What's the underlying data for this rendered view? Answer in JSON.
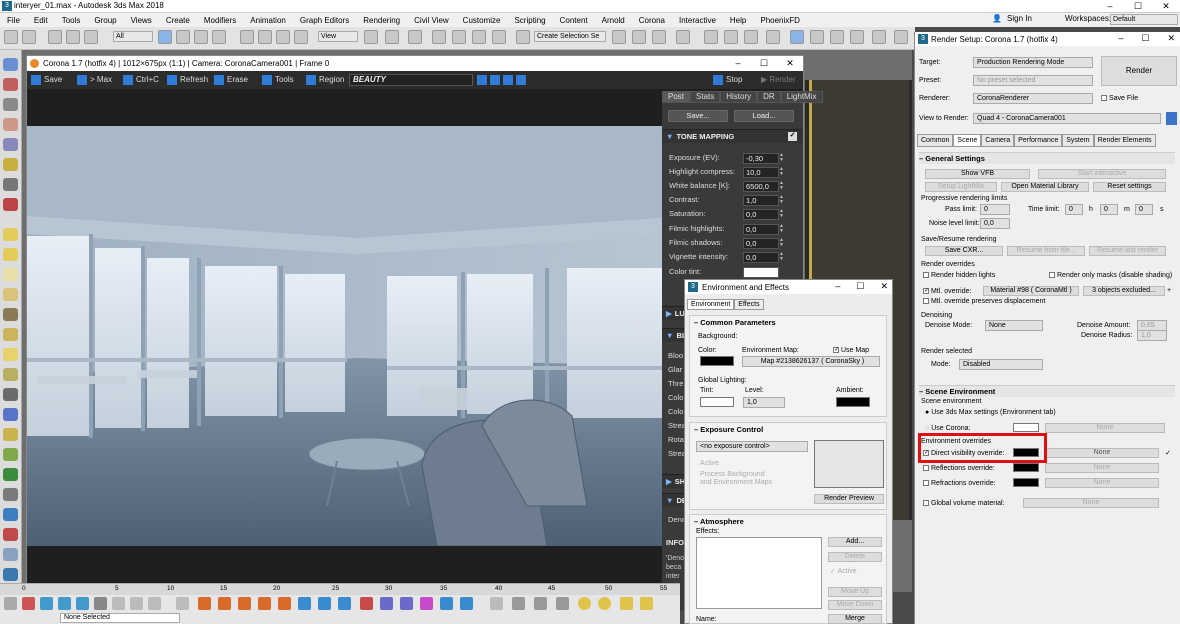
{
  "app": {
    "title": "interyer_01.max - Autodesk 3ds Max 2018",
    "icon": "3ds-max-icon"
  },
  "menu": [
    "File",
    "Edit",
    "Tools",
    "Group",
    "Views",
    "Create",
    "Modifiers",
    "Animation",
    "Graph Editors",
    "Rendering",
    "Civil View",
    "Customize",
    "Scripting",
    "Content",
    "Arnold",
    "Corona",
    "Interactive",
    "Help",
    "PhoenixFD"
  ],
  "account": {
    "sign_in": "Sign In",
    "workspaces_label": "Workspaces:",
    "workspace": "Default"
  },
  "toolbar": {
    "filter": "All",
    "view": "View",
    "selection_set": "Create Selection Se"
  },
  "vfb": {
    "title": "Corona 1.7 (hotfix 4) | 1012×675px (1:1) | Camera: CoronaCamera001 | Frame 0",
    "buttons": {
      "save": "Save",
      "max": "> Max",
      "copy": "Ctrl+C",
      "refresh": "Refresh",
      "erase": "Erase",
      "tools": "Tools",
      "region": "Region",
      "stop": "Stop",
      "render": "Render"
    },
    "channel": "BEAUTY",
    "tabs": [
      "Post",
      "Stats",
      "History",
      "DR",
      "LightMix"
    ],
    "save_btn": "Save...",
    "load_btn": "Load...",
    "tone_mapping": "TONE MAPPING",
    "tm_rows": [
      {
        "label": "Exposure (EV):",
        "value": "-0,30"
      },
      {
        "label": "Highlight compress:",
        "value": "10,0"
      },
      {
        "label": "White balance [K]:",
        "value": "6500,0"
      },
      {
        "label": "Contrast:",
        "value": "1,0"
      },
      {
        "label": "Saturation:",
        "value": "0,0"
      },
      {
        "label": "Filmic highlights:",
        "value": "0,0"
      },
      {
        "label": "Filmic shadows:",
        "value": "0,0"
      },
      {
        "label": "Vignette intensity:",
        "value": "0,0"
      },
      {
        "label": "Color tint:",
        "value": ""
      }
    ],
    "cut_sections": [
      "LUT",
      "BLO",
      "SHA",
      "DEN",
      "INFO"
    ],
    "cut_labels": [
      "Bloo",
      "Glar",
      "Thre",
      "Colo",
      "Colo",
      "Strea",
      "Rota",
      "Strea",
      "Deno"
    ],
    "info_text": [
      "'Deno",
      "beca",
      "inter"
    ]
  },
  "env": {
    "title": "Environment and Effects",
    "tabs": [
      "Environment",
      "Effects"
    ],
    "common": "Common Parameters",
    "background": "Background:",
    "color": "Color:",
    "env_map": "Environment Map:",
    "use_map": "Use Map",
    "map_name": "Map #2138626137  ( CoronaSky )",
    "global_lighting": "Global Lighting:",
    "tint": "Tint:",
    "level": "Level:",
    "level_value": "1,0",
    "ambient": "Ambient:",
    "exposure": "Exposure Control",
    "exposure_value": "<no exposure control>",
    "active": "Active",
    "process_bg": "Process Background\nand Environment Maps",
    "render_preview": "Render Preview",
    "atmosphere": "Atmosphere",
    "effects": "Effects:",
    "add": "Add...",
    "delete": "Delete",
    "active2": "Active",
    "move_up": "Move Up",
    "move_down": "Move Down",
    "name": "Name:",
    "merge": "Merge"
  },
  "render_setup": {
    "title": "Render Setup: Corona 1.7 (hotfix 4)",
    "target_label": "Target:",
    "target": "Production Rendering Mode",
    "preset_label": "Preset:",
    "preset": "No preset selected",
    "renderer_label": "Renderer:",
    "renderer": "CoronaRenderer",
    "save_file": "Save File",
    "render_btn": "Render",
    "view_label": "View to Render:",
    "view": "Quad 4 - CoronaCamera001",
    "tabs": [
      "Common",
      "Scene",
      "Camera",
      "Performance",
      "System",
      "Render Elements"
    ],
    "general": "General Settings",
    "show_vfb": "Show VFB",
    "start_interactive": "Start interactive",
    "setup_lightmix": "Setup LightMix",
    "open_matlib": "Open Material Library",
    "reset_settings": "Reset settings",
    "prog_limits": "Progressive rendering limits",
    "pass_limit": "Pass limit:",
    "time_limit": "Time limit:",
    "zero": "0",
    "h": "h",
    "m": "m",
    "s": "s",
    "noise_limit": "Noise level limit:",
    "noise_val": "0,0",
    "save_resume": "Save/Resume rendering",
    "save_cxr": "Save CXR...",
    "resume": "Resume from file...",
    "resume_last": "Resume last render",
    "render_overrides": "Render overrides",
    "render_hidden": "Render hidden lights",
    "render_masks": "Render only masks (disable shading)",
    "mtl_override": "Mtl. override:",
    "material": "Material #98  ( CoronaMtl )",
    "excluded": "3 objects excluded...",
    "mtl_disp": "Mtl. override preserves displacement",
    "denoising": "Denoising",
    "denoise_mode": "Denoise Mode:",
    "denoise_val": "None",
    "denoise_amount": "Denoise Amount:",
    "amount_val": "0,65",
    "denoise_radius": "Denoise Radius:",
    "radius_val": "1,0",
    "render_selected": "Render selected",
    "mode": "Mode:",
    "mode_val": "Disabled",
    "scene_env": "Scene Environment",
    "scene_env_sub": "Scene environment",
    "use_max": "Use 3ds Max settings (Environment tab)",
    "use_corona": "Use Corona:",
    "none": "None",
    "env_overrides": "Environment overrides",
    "direct_vis": "Direct visibility override:",
    "reflections": "Reflections override:",
    "refractions": "Refractions override:",
    "global_volume": "Global volume material:"
  },
  "timeline": {
    "ticks": [
      "0",
      "5",
      "10",
      "15",
      "20",
      "25",
      "30",
      "35",
      "40",
      "45",
      "50",
      "55"
    ]
  },
  "status": {
    "text": "None Selected"
  }
}
